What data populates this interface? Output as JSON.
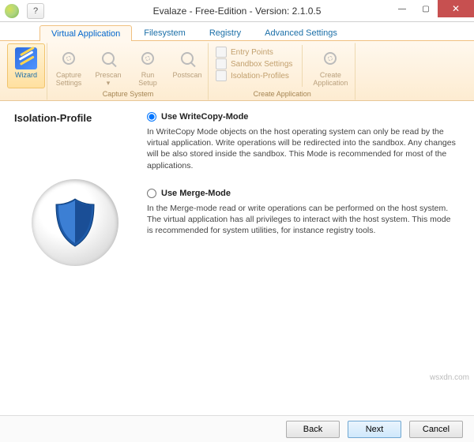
{
  "window": {
    "title": "Evalaze - Free-Edition - Version: 2.1.0.5"
  },
  "tabs": [
    {
      "label": "Virtual Application",
      "active": true
    },
    {
      "label": "Filesystem"
    },
    {
      "label": "Registry"
    },
    {
      "label": "Advanced Settings"
    }
  ],
  "ribbon": {
    "wizard": {
      "label": "Wizard"
    },
    "capture_group_label": "Capture System",
    "capture_settings": "Capture\nSettings",
    "prescan": "Prescan\n▾",
    "run_setup": "Run\nSetup",
    "postscan": "Postscan",
    "create_group_label": "Create Application",
    "entry_points": "Entry Points",
    "sandbox_settings": "Sandbox Settings",
    "isolation_profiles": "Isolation-Profiles",
    "create_app": "Create\nApplication"
  },
  "section_title": "Isolation-Profile",
  "options": {
    "writecopy": {
      "label": "Use WriteCopy-Mode",
      "desc": "In WriteCopy Mode objects on the host operating system can only be read by the virtual application. Write operations will be redirected into the sandbox. Any changes will be also stored inside the sandbox. This Mode is recommended for most of the applications."
    },
    "merge": {
      "label": "Use Merge-Mode",
      "desc": "In the Merge-mode read or write operations can be performed on the host system. The virtual application has all privileges to interact with the host system. This mode is recommended for system utilities, for instance registry tools."
    }
  },
  "footer": {
    "back": "Back",
    "next": "Next",
    "cancel": "Cancel"
  },
  "watermark": "wsxdn.com"
}
